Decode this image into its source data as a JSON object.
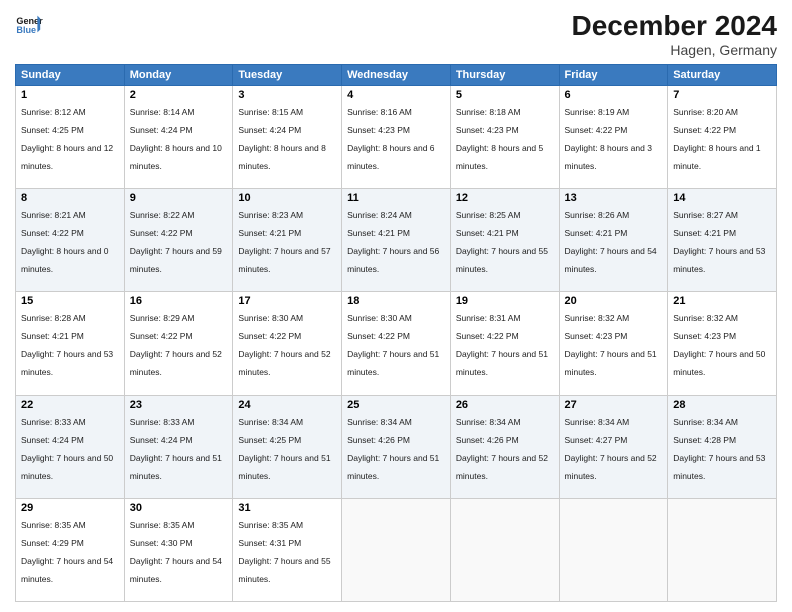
{
  "header": {
    "logo_line1": "General",
    "logo_line2": "Blue",
    "month": "December 2024",
    "location": "Hagen, Germany"
  },
  "weekdays": [
    "Sunday",
    "Monday",
    "Tuesday",
    "Wednesday",
    "Thursday",
    "Friday",
    "Saturday"
  ],
  "weeks": [
    [
      {
        "day": "1",
        "sunrise": "8:12 AM",
        "sunset": "4:25 PM",
        "daylight": "8 hours and 12 minutes."
      },
      {
        "day": "2",
        "sunrise": "8:14 AM",
        "sunset": "4:24 PM",
        "daylight": "8 hours and 10 minutes."
      },
      {
        "day": "3",
        "sunrise": "8:15 AM",
        "sunset": "4:24 PM",
        "daylight": "8 hours and 8 minutes."
      },
      {
        "day": "4",
        "sunrise": "8:16 AM",
        "sunset": "4:23 PM",
        "daylight": "8 hours and 6 minutes."
      },
      {
        "day": "5",
        "sunrise": "8:18 AM",
        "sunset": "4:23 PM",
        "daylight": "8 hours and 5 minutes."
      },
      {
        "day": "6",
        "sunrise": "8:19 AM",
        "sunset": "4:22 PM",
        "daylight": "8 hours and 3 minutes."
      },
      {
        "day": "7",
        "sunrise": "8:20 AM",
        "sunset": "4:22 PM",
        "daylight": "8 hours and 1 minute."
      }
    ],
    [
      {
        "day": "8",
        "sunrise": "8:21 AM",
        "sunset": "4:22 PM",
        "daylight": "8 hours and 0 minutes."
      },
      {
        "day": "9",
        "sunrise": "8:22 AM",
        "sunset": "4:22 PM",
        "daylight": "7 hours and 59 minutes."
      },
      {
        "day": "10",
        "sunrise": "8:23 AM",
        "sunset": "4:21 PM",
        "daylight": "7 hours and 57 minutes."
      },
      {
        "day": "11",
        "sunrise": "8:24 AM",
        "sunset": "4:21 PM",
        "daylight": "7 hours and 56 minutes."
      },
      {
        "day": "12",
        "sunrise": "8:25 AM",
        "sunset": "4:21 PM",
        "daylight": "7 hours and 55 minutes."
      },
      {
        "day": "13",
        "sunrise": "8:26 AM",
        "sunset": "4:21 PM",
        "daylight": "7 hours and 54 minutes."
      },
      {
        "day": "14",
        "sunrise": "8:27 AM",
        "sunset": "4:21 PM",
        "daylight": "7 hours and 53 minutes."
      }
    ],
    [
      {
        "day": "15",
        "sunrise": "8:28 AM",
        "sunset": "4:21 PM",
        "daylight": "7 hours and 53 minutes."
      },
      {
        "day": "16",
        "sunrise": "8:29 AM",
        "sunset": "4:22 PM",
        "daylight": "7 hours and 52 minutes."
      },
      {
        "day": "17",
        "sunrise": "8:30 AM",
        "sunset": "4:22 PM",
        "daylight": "7 hours and 52 minutes."
      },
      {
        "day": "18",
        "sunrise": "8:30 AM",
        "sunset": "4:22 PM",
        "daylight": "7 hours and 51 minutes."
      },
      {
        "day": "19",
        "sunrise": "8:31 AM",
        "sunset": "4:22 PM",
        "daylight": "7 hours and 51 minutes."
      },
      {
        "day": "20",
        "sunrise": "8:32 AM",
        "sunset": "4:23 PM",
        "daylight": "7 hours and 51 minutes."
      },
      {
        "day": "21",
        "sunrise": "8:32 AM",
        "sunset": "4:23 PM",
        "daylight": "7 hours and 50 minutes."
      }
    ],
    [
      {
        "day": "22",
        "sunrise": "8:33 AM",
        "sunset": "4:24 PM",
        "daylight": "7 hours and 50 minutes."
      },
      {
        "day": "23",
        "sunrise": "8:33 AM",
        "sunset": "4:24 PM",
        "daylight": "7 hours and 51 minutes."
      },
      {
        "day": "24",
        "sunrise": "8:34 AM",
        "sunset": "4:25 PM",
        "daylight": "7 hours and 51 minutes."
      },
      {
        "day": "25",
        "sunrise": "8:34 AM",
        "sunset": "4:26 PM",
        "daylight": "7 hours and 51 minutes."
      },
      {
        "day": "26",
        "sunrise": "8:34 AM",
        "sunset": "4:26 PM",
        "daylight": "7 hours and 52 minutes."
      },
      {
        "day": "27",
        "sunrise": "8:34 AM",
        "sunset": "4:27 PM",
        "daylight": "7 hours and 52 minutes."
      },
      {
        "day": "28",
        "sunrise": "8:34 AM",
        "sunset": "4:28 PM",
        "daylight": "7 hours and 53 minutes."
      }
    ],
    [
      {
        "day": "29",
        "sunrise": "8:35 AM",
        "sunset": "4:29 PM",
        "daylight": "7 hours and 54 minutes."
      },
      {
        "day": "30",
        "sunrise": "8:35 AM",
        "sunset": "4:30 PM",
        "daylight": "7 hours and 54 minutes."
      },
      {
        "day": "31",
        "sunrise": "8:35 AM",
        "sunset": "4:31 PM",
        "daylight": "7 hours and 55 minutes."
      },
      null,
      null,
      null,
      null
    ]
  ],
  "labels": {
    "sunrise": "Sunrise:",
    "sunset": "Sunset:",
    "daylight": "Daylight:"
  }
}
